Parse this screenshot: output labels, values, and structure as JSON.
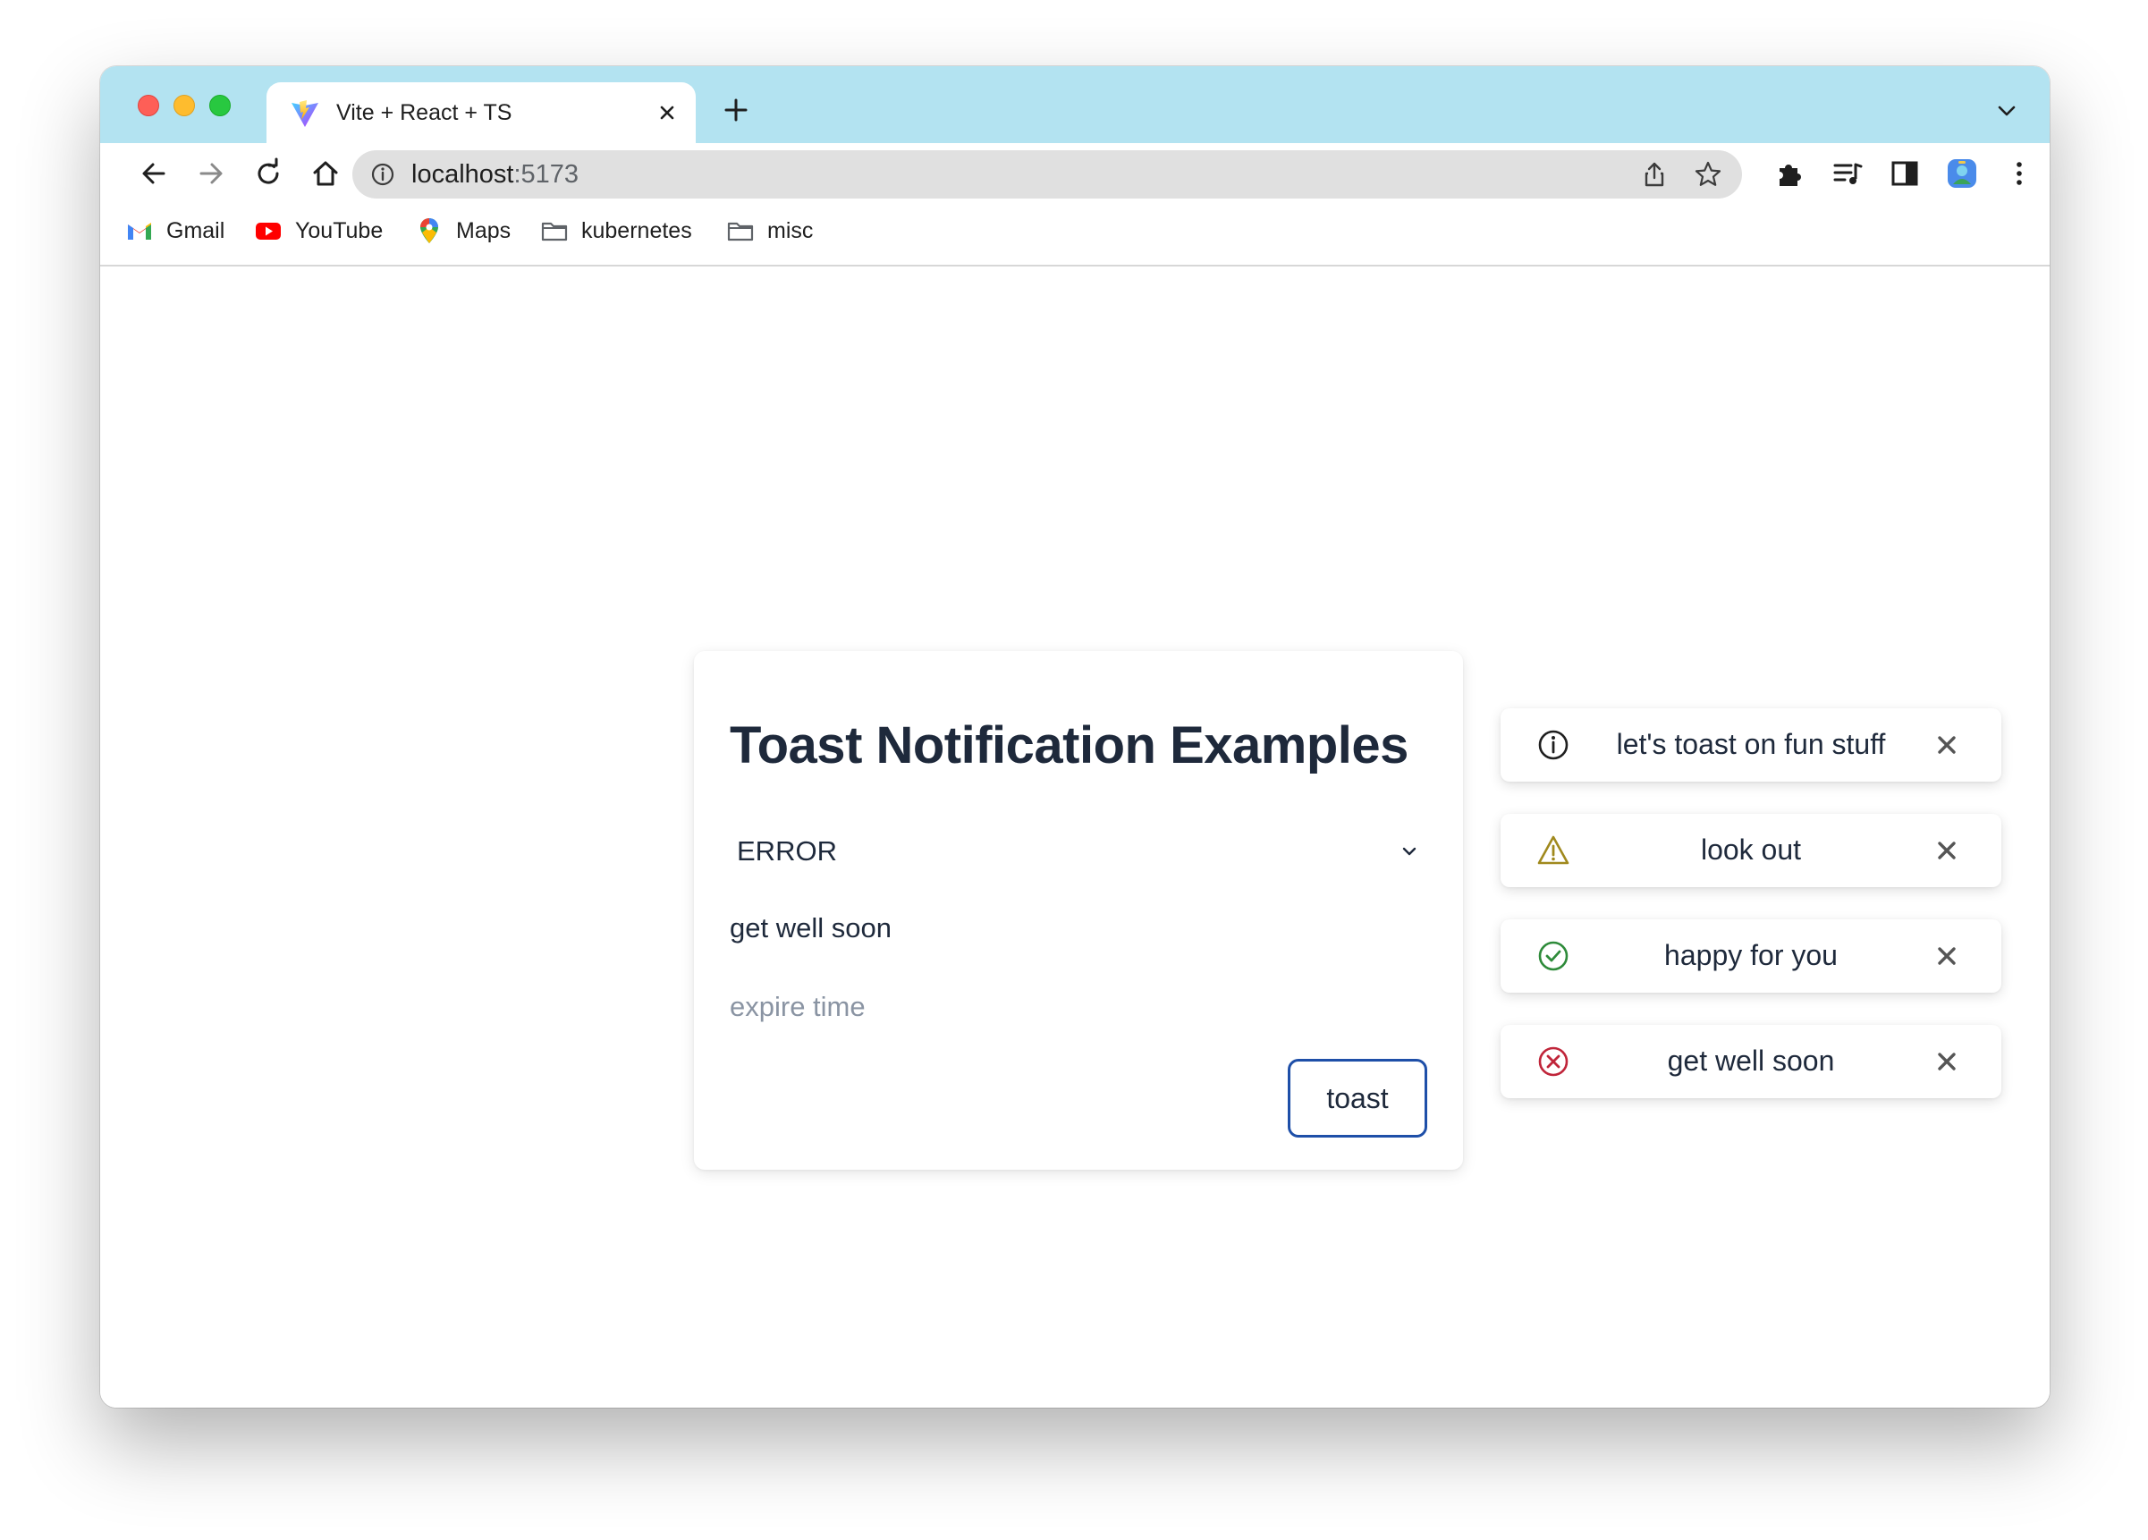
{
  "browser": {
    "tab_title": "Vite + React + TS",
    "url_host": "localhost",
    "url_port": ":5173",
    "bookmarks": [
      {
        "label": "Gmail",
        "icon": "gmail-icon"
      },
      {
        "label": "YouTube",
        "icon": "youtube-icon"
      },
      {
        "label": "Maps",
        "icon": "maps-icon"
      },
      {
        "label": "kubernetes",
        "icon": "folder-icon"
      },
      {
        "label": "misc",
        "icon": "folder-icon"
      }
    ]
  },
  "card": {
    "title": "Toast Notification Examples",
    "select_value": "ERROR",
    "message_value": "get well soon",
    "expire_placeholder": "expire time",
    "button_label": "toast"
  },
  "toasts": [
    {
      "type": "info",
      "message": "let's toast on fun stuff",
      "color": "#1f1f1f"
    },
    {
      "type": "warning",
      "message": "look out",
      "color": "#a0891d"
    },
    {
      "type": "success",
      "message": "happy for you",
      "color": "#2e8b3a"
    },
    {
      "type": "error",
      "message": "get well soon",
      "color": "#c0253a"
    }
  ],
  "colors": {
    "tabstrip": "#b3e3f1",
    "text_dark": "#1e293b",
    "button_border": "#1e4fa8",
    "placeholder": "#8a94a3"
  }
}
